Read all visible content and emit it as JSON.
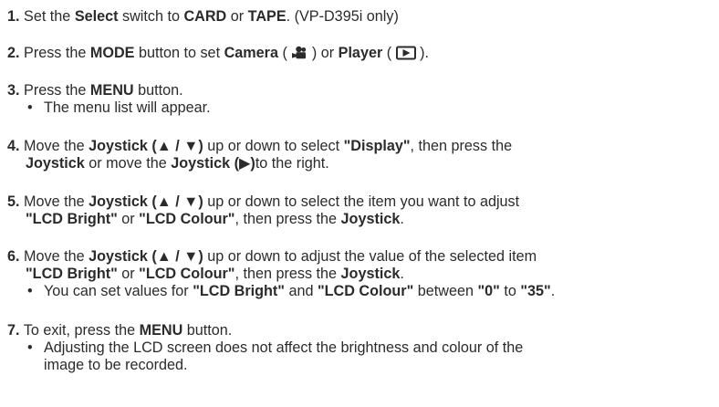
{
  "steps": [
    {
      "num": "1.",
      "t1": "Set the ",
      "b1": "Select",
      "t2": " switch to ",
      "b2": "CARD",
      "t3": " or ",
      "b3": "TAPE",
      "t4": ". (VP-D395i only)"
    },
    {
      "num": "2.",
      "t1": "Press the ",
      "b1": "MODE",
      "t2": " button to set ",
      "b2": "Camera",
      "t3": " ( ",
      "t4": " ) or ",
      "b3": "Player",
      "t5": " ( ",
      "t6": " ).",
      "icon_camera": "camera-mode-icon",
      "icon_player": "player-mode-icon"
    },
    {
      "num": "3.",
      "t1": "Press the ",
      "b1": "MENU",
      "t2": " button.",
      "bullets": [
        "The menu list will appear."
      ]
    },
    {
      "num": "4.",
      "t1": "Move the ",
      "b1": "Joystick (▲ / ▼)",
      "t2": " up or down to select ",
      "b2": "\"Display\"",
      "t3": ", then press the",
      "b3": "Joystick",
      "t4": " or move the ",
      "b4": "Joystick (▶)",
      "t5": "to the right."
    },
    {
      "num": "5.",
      "t1": "Move the ",
      "b1": "Joystick (▲ / ▼)",
      "t2": " up or down to select the item you want to adjust",
      "b2": "\"LCD Bright\"",
      "t3": " or ",
      "b3": "\"LCD Colour\"",
      "t4": ", then press the ",
      "b4": "Joystick",
      "t5": "."
    },
    {
      "num": "6.",
      "t1": "Move the ",
      "b1": "Joystick (▲ / ▼)",
      "t2": " up or down to adjust the value of the selected item",
      "b2": "\"LCD Bright\"",
      "t3": " or ",
      "b3": "\"LCD Colour\"",
      "t4": ", then press the ",
      "b4": "Joystick",
      "t5": ".",
      "bullet": {
        "t1": "You can set values for ",
        "b1": "\"LCD Bright\"",
        "t2": " and ",
        "b2": "\"LCD Colour\"",
        "t3": " between ",
        "b3": "\"0\"",
        "t4": " to ",
        "b4": "\"35\"",
        "t5": "."
      }
    },
    {
      "num": "7.",
      "t1": "To exit, press the ",
      "b1": "MENU",
      "t2": " button.",
      "bullet_l1": "Adjusting the LCD screen does not affect the brightness and colour of the",
      "bullet_l2": "image to be recorded."
    }
  ],
  "bullet_char": "•",
  "colors": {
    "text": "#2b2b2b",
    "background": "#ffffff"
  }
}
